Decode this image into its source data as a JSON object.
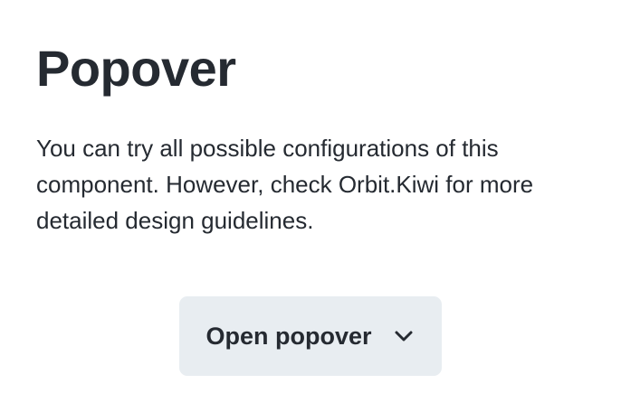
{
  "page": {
    "title": "Popover",
    "description": "You can try all possible configurations of this component. However, check Orbit.Kiwi for more detailed design guidelines."
  },
  "popover_button": {
    "label": "Open popover",
    "icon": "chevron-down-icon"
  },
  "colors": {
    "text": "#252a31",
    "button_background": "#e8edf1",
    "page_background": "#ffffff"
  }
}
